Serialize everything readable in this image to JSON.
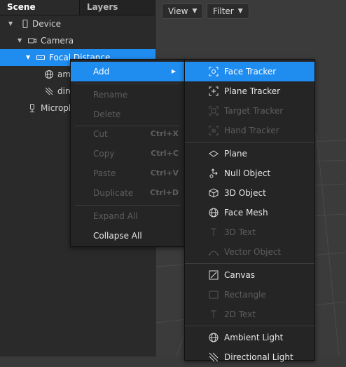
{
  "tabs": {
    "scene": "Scene",
    "layers": "Layers"
  },
  "viewport": {
    "view_label": "View",
    "filter_label": "Filter"
  },
  "tree": {
    "device": "Device",
    "camera": "Camera",
    "focal_distance": "Focal Distance",
    "ambient": "aml",
    "directional": "dire",
    "microphone": "Microph"
  },
  "context_menu": {
    "add": "Add",
    "rename": "Rename",
    "delete": "Delete",
    "cut": "Cut",
    "cut_shortcut": "Ctrl+X",
    "copy": "Copy",
    "copy_shortcut": "Ctrl+C",
    "paste": "Paste",
    "paste_shortcut": "Ctrl+V",
    "duplicate": "Duplicate",
    "duplicate_shortcut": "Ctrl+D",
    "expand_all": "Expand All",
    "collapse_all": "Collapse All"
  },
  "add_menu": {
    "face_tracker": "Face Tracker",
    "plane_tracker": "Plane Tracker",
    "target_tracker": "Target Tracker",
    "hand_tracker": "Hand Tracker",
    "plane": "Plane",
    "null_object": "Null Object",
    "object_3d": "3D Object",
    "face_mesh": "Face Mesh",
    "text_3d": "3D Text",
    "vector_object": "Vector Object",
    "canvas": "Canvas",
    "rectangle": "Rectangle",
    "text_2d": "2D Text",
    "ambient_light": "Ambient Light",
    "directional_light": "Directional Light"
  },
  "colors": {
    "accent": "#1f8cf0",
    "panel": "#2a2a2a",
    "menu": "#252525",
    "disabled": "#5e5e5e"
  }
}
